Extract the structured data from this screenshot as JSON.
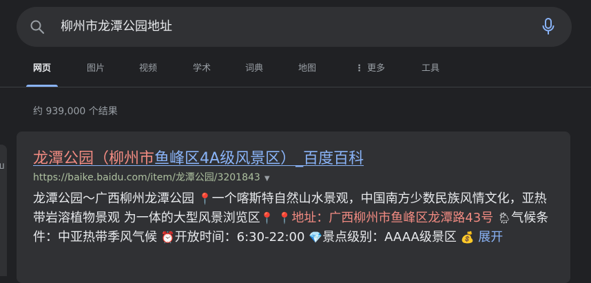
{
  "search": {
    "query": "柳州市龙潭公园地址"
  },
  "tabs": {
    "web": "网页",
    "images": "图片",
    "videos": "视频",
    "scholar": "学术",
    "dictionary": "词典",
    "maps": "地图",
    "more": "更多",
    "tools": "工具"
  },
  "stats": {
    "text": "约 939,000 个结果"
  },
  "result": {
    "title_part1": "龙潭公园（柳州市",
    "title_part2": "鱼峰区4A级风景区）_百度百科",
    "url": "https://baike.baidu.com/item/龙潭公园/3201843",
    "snippet": {
      "s1": "龙潭公园～广西柳州龙潭公园 ",
      "s2": "一个喀斯特自然山水景观，中国南方少数民族风情文化，亚热带岩溶植物景观 为一体的大型风景浏览区",
      "s3": "地址：广西柳州市鱼峰区龙潭路43号",
      "s4": "气候条件：中亚热带季风气候 ",
      "s5": "开放时间：6:30-22:00 ",
      "s6": "景点级别：AAAA级景区 ",
      "expand": "展开"
    }
  },
  "colors": {
    "background": "#202124",
    "card": "#303134",
    "link": "#8ab4f8",
    "highlight": "#f28b82",
    "url": "#aec1a0"
  }
}
